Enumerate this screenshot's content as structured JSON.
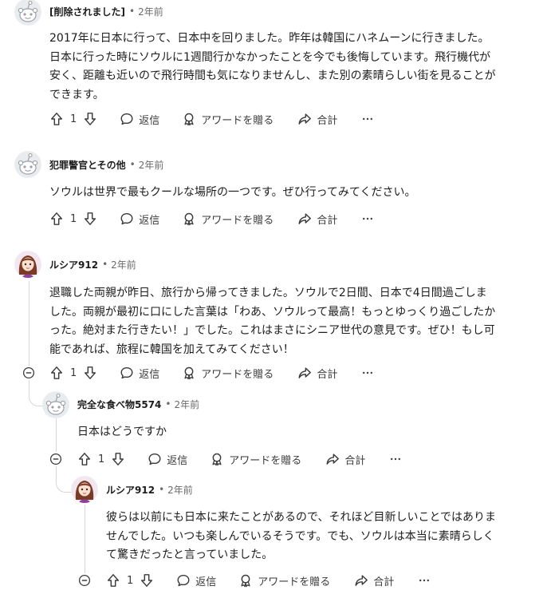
{
  "comments": [
    {
      "author": "[削除されました]",
      "sep": "•",
      "time": "2年前",
      "body": "2017年に日本に行って、日本中を回りました。昨年は韓国にハネムーンに行きました。\n日本に行った時にソウルに1週間行かなかったことを今でも後悔しています。飛行機代が\n安く、距離も近いので飛行時間も気になりませんし、また別の素晴らしい街を見ることが\nできます。",
      "votes": "1",
      "reply": "返信",
      "award": "アワードを贈る",
      "share": "合計",
      "more": "…"
    },
    {
      "author": "犯罪警官とその他",
      "sep": "•",
      "time": "2年前",
      "body": "ソウルは世界で最もクールな場所の一つです。ぜひ行ってみてください。",
      "votes": "1",
      "reply": "返信",
      "award": "アワードを贈る",
      "share": "合計",
      "more": "…"
    },
    {
      "author": "ルシア912",
      "sep": "•",
      "time": "2年前",
      "body": "退職した両親が昨日、旅行から帰ってきました。ソウルで2日間、日本で4日間過ごしま\nした。両親が最初に口にした言葉は「わあ、ソウルって最高！もっとゆっくり過ごしたか\nった。絶対また行きたい！」でした。これはまさにシニア世代の意見です。ぜひ！もし可\n能であれば、旅程に韓国を加えてみてください！",
      "votes": "1",
      "reply": "返信",
      "award": "アワードを贈る",
      "share": "合計",
      "more": "…"
    },
    {
      "author": "完全な食べ物5574",
      "sep": "•",
      "time": "2年前",
      "body": "日本はどうですか",
      "votes": "1",
      "reply": "返信",
      "award": "アワードを贈る",
      "share": "合計",
      "more": "…"
    },
    {
      "author": "ルシア912",
      "sep": "•",
      "time": "2年前",
      "body": "彼らは以前にも日本に来たことがあるので、それほど目新しいことではありま\nせんでした。いつも楽しんでいるそうです。でも、ソウルは本当に素晴らしく\nて驚きだったと言っていました。",
      "votes": "1",
      "reply": "返信",
      "award": "アワードを贈る",
      "share": "合計",
      "more": "…"
    }
  ],
  "colors": {
    "text": "#1c1c1c",
    "meta": "#6a6a6a",
    "line": "#d6d6d6",
    "avatar_hair": "#7a3b26",
    "avatar_bg": "#f3e7ef"
  },
  "icons": [
    "snoo-avatar-icon",
    "anime-girl-avatar-icon",
    "upvote-icon",
    "downvote-icon",
    "comment-icon",
    "award-icon",
    "share-icon",
    "more-icon",
    "collapse-icon"
  ]
}
